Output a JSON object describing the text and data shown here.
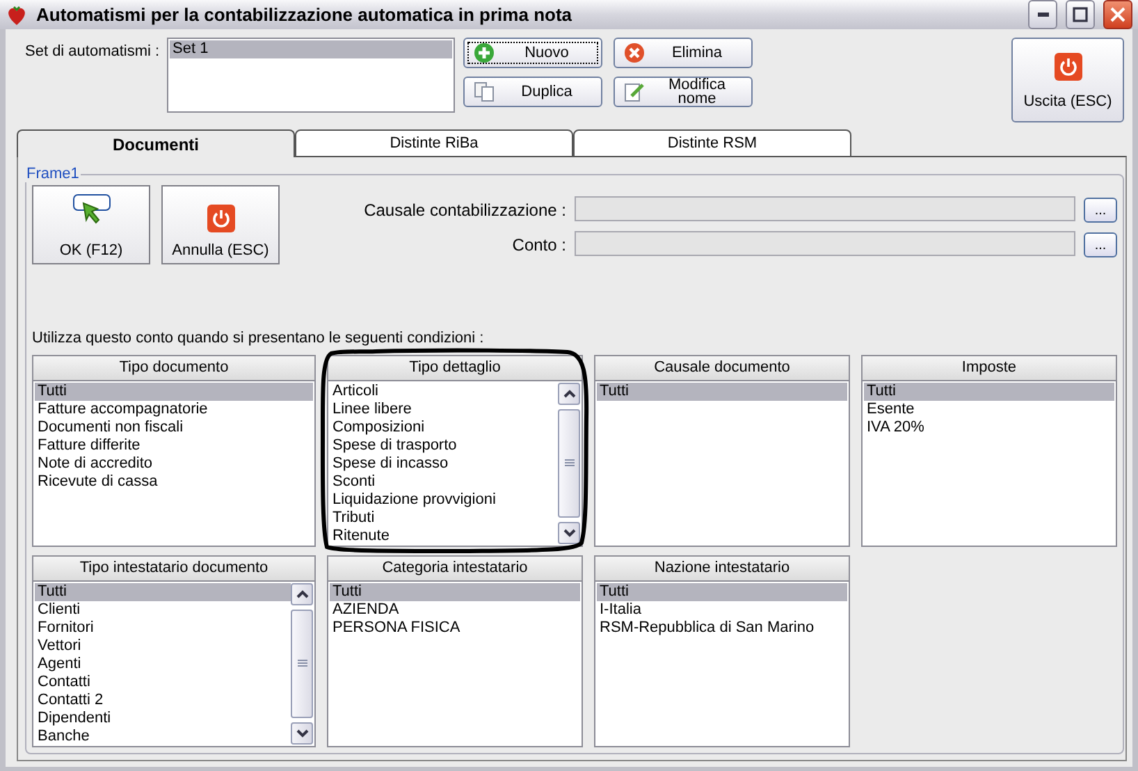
{
  "window": {
    "title": "Automatismi per la contabilizzazione automatica in prima nota"
  },
  "set": {
    "label": "Set di automatismi :",
    "items": [
      {
        "label": "Set 1",
        "selected": true
      }
    ]
  },
  "actions": [
    {
      "label": "Nuovo",
      "kind": "add",
      "focused": true
    },
    {
      "label": "Elimina",
      "kind": "delete",
      "focused": false
    },
    {
      "label": "Duplica",
      "kind": "copy",
      "focused": false
    },
    {
      "label": "Modifica nome",
      "kind": "edit",
      "focused": false
    }
  ],
  "exit_button": {
    "label": "Uscita (ESC)"
  },
  "tabs": [
    {
      "label": "Documenti",
      "selected": true
    },
    {
      "label": "Distinte RiBa",
      "selected": false
    },
    {
      "label": "Distinte RSM",
      "selected": false
    }
  ],
  "frame": {
    "title": "Frame1",
    "buttons": [
      {
        "label": "OK (F12)",
        "kind": "ok"
      },
      {
        "label": "Annulla (ESC)",
        "kind": "cancel"
      }
    ],
    "fields": [
      {
        "label": "Causale contabilizzazione :",
        "button": "..."
      },
      {
        "label": "Conto :",
        "button": "..."
      }
    ],
    "hint": "Utilizza questo conto quando si presentano le seguenti condizioni :",
    "lists": [
      {
        "header": "Tipo documento",
        "scrollbar": false,
        "items": [
          {
            "label": "Tutti",
            "selected": true
          },
          {
            "label": "Fatture accompagnatorie",
            "selected": false
          },
          {
            "label": "Documenti non fiscali",
            "selected": false
          },
          {
            "label": "Fatture differite",
            "selected": false
          },
          {
            "label": "Note di accredito",
            "selected": false
          },
          {
            "label": "Ricevute di cassa",
            "selected": false
          }
        ]
      },
      {
        "header": "Tipo dettaglio",
        "scrollbar": true,
        "circled": true,
        "items": [
          {
            "label": "Articoli",
            "selected": false
          },
          {
            "label": "Linee libere",
            "selected": false
          },
          {
            "label": "Composizioni",
            "selected": false
          },
          {
            "label": "Spese di trasporto",
            "selected": false
          },
          {
            "label": "Spese di incasso",
            "selected": false
          },
          {
            "label": "Sconti",
            "selected": false
          },
          {
            "label": "Liquidazione provvigioni",
            "selected": false
          },
          {
            "label": "Tributi",
            "selected": false
          },
          {
            "label": "Ritenute",
            "selected": false
          }
        ]
      },
      {
        "header": "Causale documento",
        "scrollbar": false,
        "items": [
          {
            "label": "Tutti",
            "selected": true
          }
        ]
      },
      {
        "header": "Imposte",
        "scrollbar": false,
        "items": [
          {
            "label": "Tutti",
            "selected": true
          },
          {
            "label": "Esente",
            "selected": false
          },
          {
            "label": "IVA 20%",
            "selected": false
          }
        ]
      },
      {
        "header": "Tipo intestatario documento",
        "scrollbar": true,
        "items": [
          {
            "label": "Tutti",
            "selected": true
          },
          {
            "label": "Clienti",
            "selected": false
          },
          {
            "label": "Fornitori",
            "selected": false
          },
          {
            "label": "Vettori",
            "selected": false
          },
          {
            "label": "Agenti",
            "selected": false
          },
          {
            "label": "Contatti",
            "selected": false
          },
          {
            "label": "Contatti 2",
            "selected": false
          },
          {
            "label": "Dipendenti",
            "selected": false
          },
          {
            "label": "Banche",
            "selected": false
          }
        ]
      },
      {
        "header": "Categoria intestatario",
        "scrollbar": false,
        "items": [
          {
            "label": "Tutti",
            "selected": true
          },
          {
            "label": "AZIENDA",
            "selected": false
          },
          {
            "label": "PERSONA FISICA",
            "selected": false
          }
        ]
      },
      {
        "header": "Nazione intestatario",
        "scrollbar": false,
        "items": [
          {
            "label": "Tutti",
            "selected": true
          },
          {
            "label": "I-Italia",
            "selected": false
          },
          {
            "label": "RSM-Repubblica di San Marino",
            "selected": false
          }
        ]
      }
    ]
  }
}
